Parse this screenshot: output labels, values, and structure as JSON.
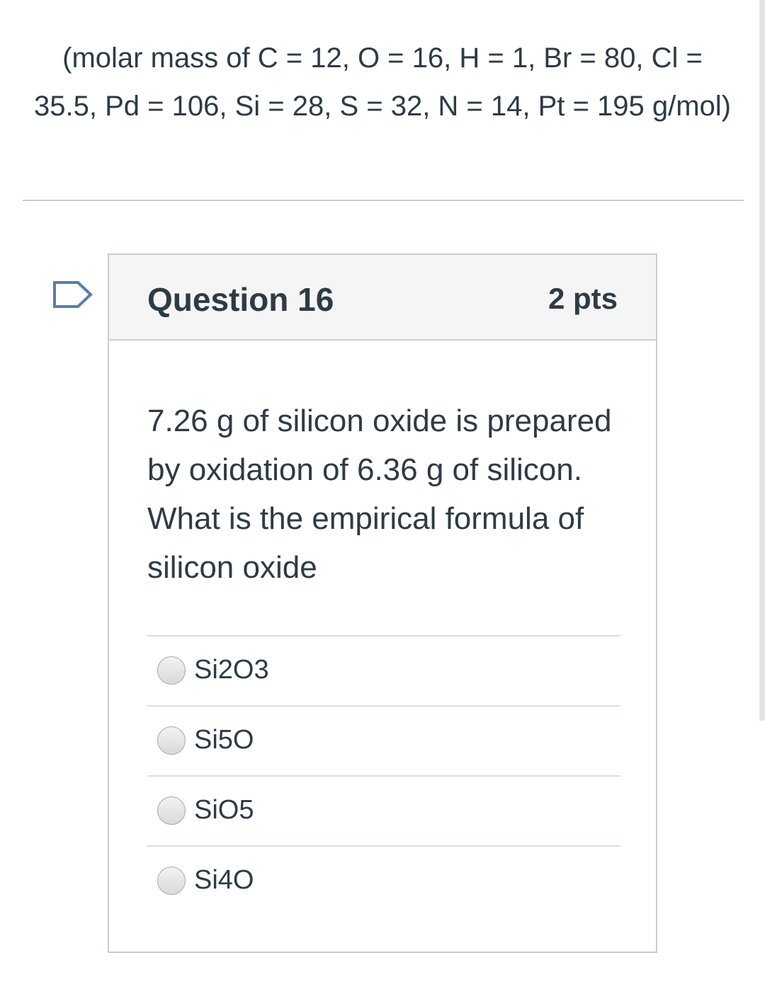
{
  "intro": {
    "molar_mass_text": "(molar mass of C = 12, O = 16, H = 1, Br = 80, Cl = 35.5, Pd = 106, Si = 28, S = 32, N = 14, Pt = 195 g/mol)"
  },
  "question": {
    "title": "Question 16",
    "points": "2 pts",
    "body": "7.26 g of silicon oxide is prepared by oxidation of 6.36 g of silicon. What is the empirical formula of silicon oxide"
  },
  "answers": [
    {
      "label": "Si2O3"
    },
    {
      "label": "Si5O"
    },
    {
      "label": "SiO5"
    },
    {
      "label": "Si4O"
    }
  ],
  "colors": {
    "text": "#2d3b45",
    "border": "#c7cdd1",
    "header_bg": "#f5f5f5",
    "flag": "#5a7ea8"
  },
  "icons": {
    "flag": "flag-icon"
  }
}
